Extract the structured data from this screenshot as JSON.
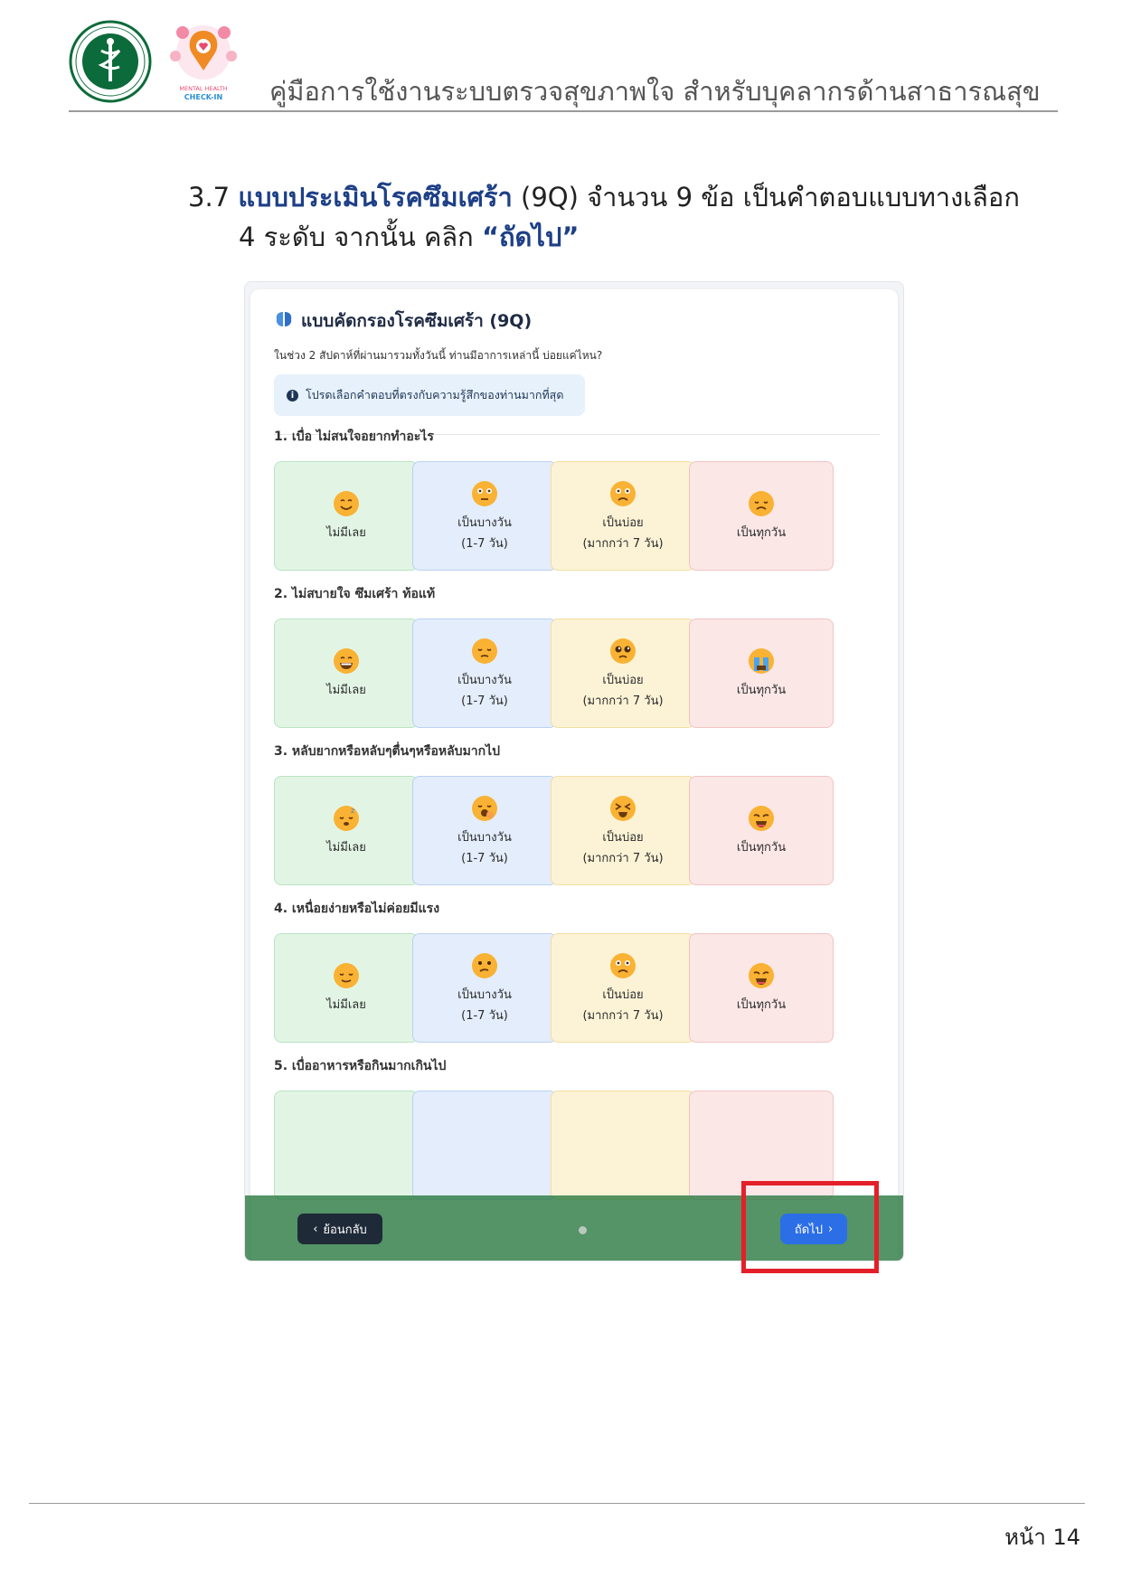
{
  "header": {
    "title": "คู่มือการใช้งานระบบตรวจสุขภาพใจ สำหรับบุคลากรด้านสาธารณสุข",
    "logo_moph_text": "MINISTRY OF PUBLIC HEALTH",
    "logo_mh_text": "MENTAL HEALTH CHECK-IN"
  },
  "instruction": {
    "number": "3.7",
    "highlight": "แบบประเมินโรคซึมเศร้า",
    "text_after": " (9Q) จำนวน 9 ข้อ เป็นคำตอบแบบทางเลือก",
    "line2_prefix": "4 ระดับ จากนั้น คลิก ",
    "line2_highlight": "“ถัดไป”"
  },
  "form": {
    "title": "แบบคัดกรองโรคซึมเศร้า (9Q)",
    "subtitle": "ในช่วง 2 สัปดาห์ที่ผ่านมารวมทั้งวันนี้ ท่านมีอาการเหล่านี้ บ่อยแค่ไหน?",
    "note": "โปรดเลือกคำตอบที่ตรงกับความรู้สึกของท่านมากที่สุด",
    "options": {
      "o1": "ไม่มีเลย",
      "o2_line1": "เป็นบางวัน",
      "o2_line2": "(1-7 วัน)",
      "o3_line1": "เป็นบ่อย",
      "o3_line2": "(มากกว่า 7 วัน)",
      "o4": "เป็นทุกวัน"
    },
    "questions": [
      {
        "label": "1. เบื่อ ไม่สนใจอยากทำอะไร"
      },
      {
        "label": "2. ไม่สบายใจ ซึมเศร้า ท้อแท้"
      },
      {
        "label": "3. หลับยากหรือหลับๆตื่นๆหรือหลับมากไป"
      },
      {
        "label": "4. เหนื่อยง่ายหรือไม่ค่อยมีแรง"
      },
      {
        "label": "5. เบื่ออาหารหรือกินมากเกินไป"
      }
    ]
  },
  "nav": {
    "back_label": "ย้อนกลับ",
    "next_label": "ถัดไป"
  },
  "footer": {
    "page": "หน้า 14"
  },
  "colors": {
    "highlight": "#1d3f86",
    "red_box": "#e3202a",
    "navbar": "#2e7d46",
    "next_button": "#2c6ee6"
  }
}
